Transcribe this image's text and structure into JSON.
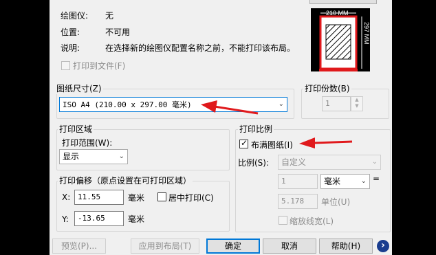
{
  "plotter": {
    "plotter_label": "绘图仪:",
    "plotter_value": "无",
    "location_label": "位置:",
    "location_value": "不可用",
    "desc_label": "说明:",
    "desc_value": "在选择新的绘图仪配置名称之前，不能打印该布局。",
    "print_to_file": "打印到文件(F)"
  },
  "preview": {
    "width_dim": "210 MM",
    "height_dim": "297 MM"
  },
  "paper_size": {
    "label": "图纸尺寸(Z)",
    "value": "ISO A4 (210.00 x 297.00 毫米)"
  },
  "copies": {
    "label": "打印份数(B)",
    "value": "1"
  },
  "plot_area": {
    "label": "打印区域",
    "what_label": "打印范围(W):",
    "what_value": "显示"
  },
  "plot_scale": {
    "label": "打印比例",
    "fit_label": "布满图纸(I)",
    "fit_checked": true,
    "scale_label": "比例(S):",
    "scale_value": "自定义",
    "num_value": "1",
    "unit_value": "毫米",
    "equals": "=",
    "den_value": "5.178",
    "den_unit": "单位(U)",
    "lineweights": "缩放线宽(L)"
  },
  "plot_offset": {
    "label": "打印偏移（原点设置在可打印区域）",
    "x_label": "X:",
    "x_value": "11.55",
    "x_unit": "毫米",
    "center_label": "居中打印(C)",
    "y_label": "Y:",
    "y_value": "-13.65",
    "y_unit": "毫米"
  },
  "buttons": {
    "preview": "预览(P)...",
    "apply": "应用到布局(T)",
    "ok": "确定",
    "cancel": "取消",
    "help": "帮助(H)",
    "more": "›"
  },
  "colors": {
    "annotation_arrow": "#e0191c",
    "accent_border": "#0078d7"
  }
}
